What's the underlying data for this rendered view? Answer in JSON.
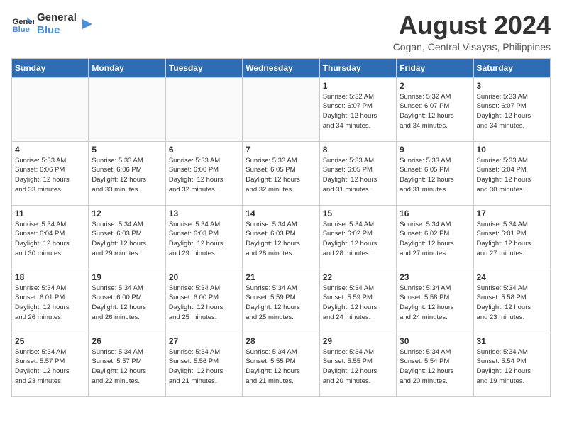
{
  "logo": {
    "line1": "General",
    "line2": "Blue"
  },
  "title": "August 2024",
  "location": "Cogan, Central Visayas, Philippines",
  "days_of_week": [
    "Sunday",
    "Monday",
    "Tuesday",
    "Wednesday",
    "Thursday",
    "Friday",
    "Saturday"
  ],
  "weeks": [
    [
      {
        "day": "",
        "info": ""
      },
      {
        "day": "",
        "info": ""
      },
      {
        "day": "",
        "info": ""
      },
      {
        "day": "",
        "info": ""
      },
      {
        "day": "1",
        "info": "Sunrise: 5:32 AM\nSunset: 6:07 PM\nDaylight: 12 hours\nand 34 minutes."
      },
      {
        "day": "2",
        "info": "Sunrise: 5:32 AM\nSunset: 6:07 PM\nDaylight: 12 hours\nand 34 minutes."
      },
      {
        "day": "3",
        "info": "Sunrise: 5:33 AM\nSunset: 6:07 PM\nDaylight: 12 hours\nand 34 minutes."
      }
    ],
    [
      {
        "day": "4",
        "info": "Sunrise: 5:33 AM\nSunset: 6:06 PM\nDaylight: 12 hours\nand 33 minutes."
      },
      {
        "day": "5",
        "info": "Sunrise: 5:33 AM\nSunset: 6:06 PM\nDaylight: 12 hours\nand 33 minutes."
      },
      {
        "day": "6",
        "info": "Sunrise: 5:33 AM\nSunset: 6:06 PM\nDaylight: 12 hours\nand 32 minutes."
      },
      {
        "day": "7",
        "info": "Sunrise: 5:33 AM\nSunset: 6:05 PM\nDaylight: 12 hours\nand 32 minutes."
      },
      {
        "day": "8",
        "info": "Sunrise: 5:33 AM\nSunset: 6:05 PM\nDaylight: 12 hours\nand 31 minutes."
      },
      {
        "day": "9",
        "info": "Sunrise: 5:33 AM\nSunset: 6:05 PM\nDaylight: 12 hours\nand 31 minutes."
      },
      {
        "day": "10",
        "info": "Sunrise: 5:33 AM\nSunset: 6:04 PM\nDaylight: 12 hours\nand 30 minutes."
      }
    ],
    [
      {
        "day": "11",
        "info": "Sunrise: 5:34 AM\nSunset: 6:04 PM\nDaylight: 12 hours\nand 30 minutes."
      },
      {
        "day": "12",
        "info": "Sunrise: 5:34 AM\nSunset: 6:03 PM\nDaylight: 12 hours\nand 29 minutes."
      },
      {
        "day": "13",
        "info": "Sunrise: 5:34 AM\nSunset: 6:03 PM\nDaylight: 12 hours\nand 29 minutes."
      },
      {
        "day": "14",
        "info": "Sunrise: 5:34 AM\nSunset: 6:03 PM\nDaylight: 12 hours\nand 28 minutes."
      },
      {
        "day": "15",
        "info": "Sunrise: 5:34 AM\nSunset: 6:02 PM\nDaylight: 12 hours\nand 28 minutes."
      },
      {
        "day": "16",
        "info": "Sunrise: 5:34 AM\nSunset: 6:02 PM\nDaylight: 12 hours\nand 27 minutes."
      },
      {
        "day": "17",
        "info": "Sunrise: 5:34 AM\nSunset: 6:01 PM\nDaylight: 12 hours\nand 27 minutes."
      }
    ],
    [
      {
        "day": "18",
        "info": "Sunrise: 5:34 AM\nSunset: 6:01 PM\nDaylight: 12 hours\nand 26 minutes."
      },
      {
        "day": "19",
        "info": "Sunrise: 5:34 AM\nSunset: 6:00 PM\nDaylight: 12 hours\nand 26 minutes."
      },
      {
        "day": "20",
        "info": "Sunrise: 5:34 AM\nSunset: 6:00 PM\nDaylight: 12 hours\nand 25 minutes."
      },
      {
        "day": "21",
        "info": "Sunrise: 5:34 AM\nSunset: 5:59 PM\nDaylight: 12 hours\nand 25 minutes."
      },
      {
        "day": "22",
        "info": "Sunrise: 5:34 AM\nSunset: 5:59 PM\nDaylight: 12 hours\nand 24 minutes."
      },
      {
        "day": "23",
        "info": "Sunrise: 5:34 AM\nSunset: 5:58 PM\nDaylight: 12 hours\nand 24 minutes."
      },
      {
        "day": "24",
        "info": "Sunrise: 5:34 AM\nSunset: 5:58 PM\nDaylight: 12 hours\nand 23 minutes."
      }
    ],
    [
      {
        "day": "25",
        "info": "Sunrise: 5:34 AM\nSunset: 5:57 PM\nDaylight: 12 hours\nand 23 minutes."
      },
      {
        "day": "26",
        "info": "Sunrise: 5:34 AM\nSunset: 5:57 PM\nDaylight: 12 hours\nand 22 minutes."
      },
      {
        "day": "27",
        "info": "Sunrise: 5:34 AM\nSunset: 5:56 PM\nDaylight: 12 hours\nand 21 minutes."
      },
      {
        "day": "28",
        "info": "Sunrise: 5:34 AM\nSunset: 5:55 PM\nDaylight: 12 hours\nand 21 minutes."
      },
      {
        "day": "29",
        "info": "Sunrise: 5:34 AM\nSunset: 5:55 PM\nDaylight: 12 hours\nand 20 minutes."
      },
      {
        "day": "30",
        "info": "Sunrise: 5:34 AM\nSunset: 5:54 PM\nDaylight: 12 hours\nand 20 minutes."
      },
      {
        "day": "31",
        "info": "Sunrise: 5:34 AM\nSunset: 5:54 PM\nDaylight: 12 hours\nand 19 minutes."
      }
    ]
  ]
}
